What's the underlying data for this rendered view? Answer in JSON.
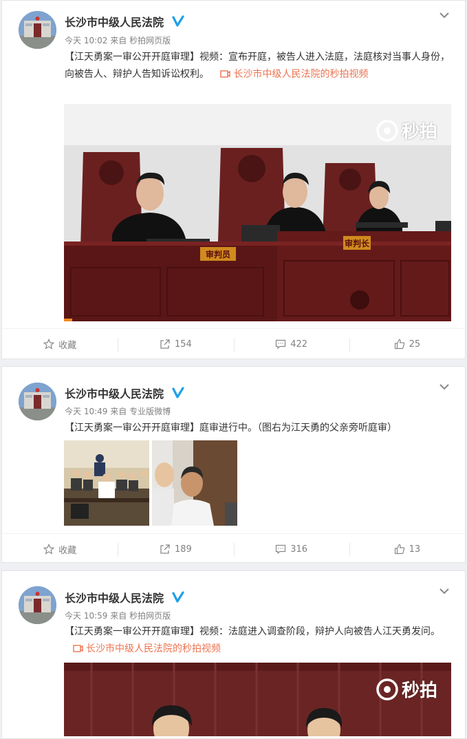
{
  "posts": [
    {
      "author": "长沙市中级人民法院",
      "time": "今天 10:02",
      "from": "来自",
      "source": "秒拍网页版",
      "text": "【江天勇案一审公开开庭审理】视频：宣布开庭，被告人进入法庭，法庭核对当事人身份，向被告人、辩护人告知诉讼权利。",
      "video_link": "长沙市中级人民法院的秒拍视频",
      "watermark": "秒拍",
      "plaque_left": "审判员",
      "plaque_center": "审判长",
      "favorite_label": "收藏",
      "reposts": "154",
      "comments": "422",
      "likes": "25"
    },
    {
      "author": "长沙市中级人民法院",
      "time": "今天 10:49",
      "from": "来自",
      "source": "专业版微博",
      "text": "【江天勇案一审公开开庭审理】庭审进行中。（图右为江天勇的父亲旁听庭审）",
      "favorite_label": "收藏",
      "reposts": "189",
      "comments": "316",
      "likes": "13"
    },
    {
      "author": "长沙市中级人民法院",
      "time": "今天 10:59",
      "from": "来自",
      "source": "秒拍网页版",
      "text": "【江天勇案一审公开开庭审理】视频：法庭进入调查阶段，辩护人向被告人江天勇发问。",
      "video_link": "长沙市中级人民法院的秒拍视频",
      "watermark": "秒拍"
    }
  ],
  "colors": {
    "link": "#eb7350",
    "verified": "#1ea0e6",
    "muted": "#808080"
  }
}
